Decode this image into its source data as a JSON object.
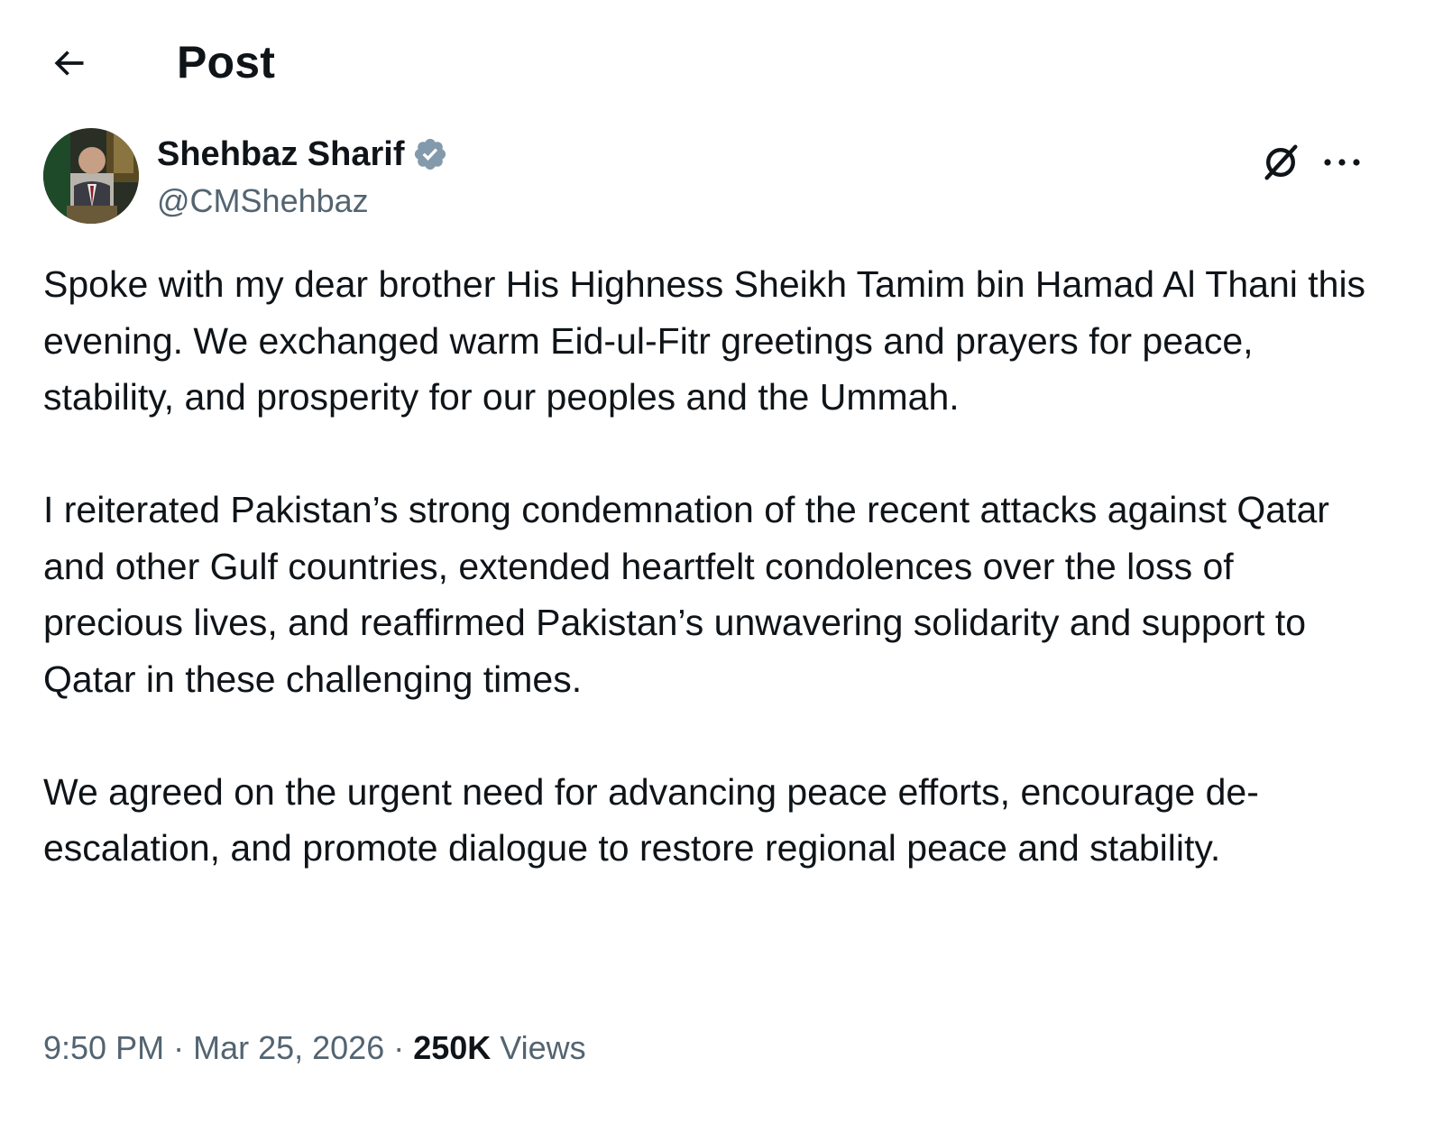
{
  "header": {
    "title": "Post",
    "back_icon": "arrow-left-icon"
  },
  "author": {
    "name": "Shehbaz Sharif",
    "handle": "@CMShehbaz",
    "verified_icon": "verified-badge-icon",
    "verified_color": "#829aab"
  },
  "actions": {
    "grok_icon": "grok-icon",
    "more_icon": "more-options-icon"
  },
  "post": {
    "paragraphs": [
      "Spoke with my dear brother His Highness Sheikh Tamim bin Hamad Al Thani this evening. We exchanged warm Eid-ul-Fitr greetings and prayers for peace, stability, and prosperity for our peoples and the Ummah.",
      "I reiterated Pakistan’s strong condemnation of  the recent attacks against Qatar and other Gulf countries, extended heartfelt condolences over the loss of precious lives, and reaffirmed Pakistan’s unwavering solidarity and support to Qatar in these challenging times.",
      "We agreed on the urgent need for advancing peace efforts, encourage de-escalation, and promote dialogue to restore regional peace and stability."
    ]
  },
  "meta": {
    "time": "9:50 PM",
    "separator": "·",
    "date": "Mar 25, 2026",
    "views_count": "250K",
    "views_label": "Views"
  },
  "colors": {
    "text_primary": "#0f1419",
    "text_secondary": "#536471",
    "background": "#ffffff"
  }
}
